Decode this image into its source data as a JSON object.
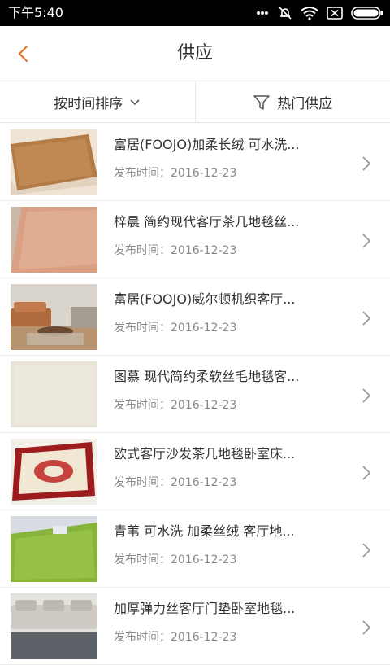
{
  "status_bar": {
    "time": "下午5:40",
    "icons": [
      "mute-icon",
      "alarm-off-icon",
      "wifi-icon",
      "close-box-icon",
      "battery-icon"
    ]
  },
  "header": {
    "back_icon": "chevron-left-icon",
    "title": "供应"
  },
  "colors": {
    "accent": "#e8702a",
    "text": "#333333",
    "muted": "#888888",
    "divider": "#e6e6e6"
  },
  "filters": {
    "sort_label": "按时间排序",
    "sort_icon": "chevron-down-icon",
    "hot_label": "热门供应",
    "hot_icon": "filter-icon"
  },
  "items": [
    {
      "title": "富居(FOOJO)加柔长绒 可水洗...",
      "date": "发布时间：2016-12-23",
      "thumb": "brown-shag-rug"
    },
    {
      "title": "梓晨 简约现代客厅茶几地毯丝...",
      "date": "发布时间：2016-12-23",
      "thumb": "pink-plush-rug"
    },
    {
      "title": "富居(FOOJO)威尔顿机织客厅...",
      "date": "发布时间：2016-12-23",
      "thumb": "living-room-rug"
    },
    {
      "title": "图慕 现代简约柔软丝毛地毯客...",
      "date": "发布时间：2016-12-23",
      "thumb": "cream-rug"
    },
    {
      "title": "欧式客厅沙发茶几地毯卧室床...",
      "date": "发布时间：2016-12-23",
      "thumb": "red-persian-rug"
    },
    {
      "title": "青苇 可水洗 加柔丝绒 客厅地...",
      "date": "发布时间：2016-12-23",
      "thumb": "green-shag-rug"
    },
    {
      "title": "加厚弹力丝客厅门垫卧室地毯...",
      "date": "发布时间：2016-12-23",
      "thumb": "grey-sofa-rug"
    }
  ]
}
